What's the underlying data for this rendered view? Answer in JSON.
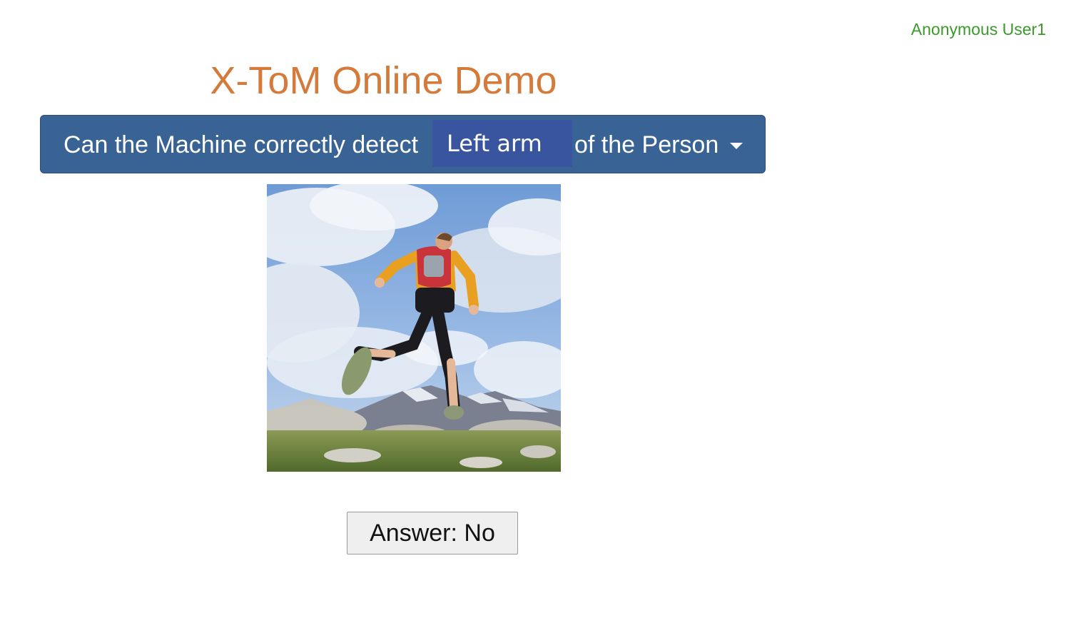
{
  "header": {
    "user_label": "Anonymous User1"
  },
  "title": "X-ToM Online Demo",
  "question": {
    "prefix": "Can the Machine correctly detect",
    "selected_part": "Left arm",
    "suffix": "of the Person"
  },
  "image": {
    "alt": "trail runner jumping over grassy rocks with mountains and cloudy sky"
  },
  "answer_button": {
    "label": "Answer: No"
  },
  "colors": {
    "title": "#d47a3a",
    "user_label": "#3a9a2a",
    "question_bar": "#3a6395",
    "selected_part_bg": "#3a55a0"
  }
}
